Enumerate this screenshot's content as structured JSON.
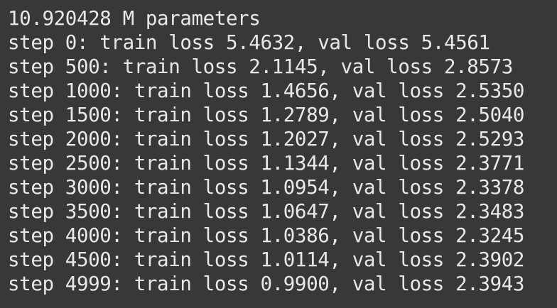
{
  "terminal": {
    "lines": [
      "10.920428 M parameters",
      "step 0: train loss 5.4632, val loss 5.4561",
      "step 500: train loss 2.1145, val loss 2.8573",
      "step 1000: train loss 1.4656, val loss 2.5350",
      "step 1500: train loss 1.2789, val loss 2.5040",
      "step 2000: train loss 1.2027, val loss 2.5293",
      "step 2500: train loss 1.1344, val loss 2.3771",
      "step 3000: train loss 1.0954, val loss 2.3378",
      "step 3500: train loss 1.0647, val loss 2.3483",
      "step 4000: train loss 1.0386, val loss 2.3245",
      "step 4500: train loss 1.0114, val loss 2.3902",
      "step 4999: train loss 0.9900, val loss 2.3943"
    ]
  },
  "colors": {
    "background": "#383838",
    "text": "#e8e8e8"
  }
}
